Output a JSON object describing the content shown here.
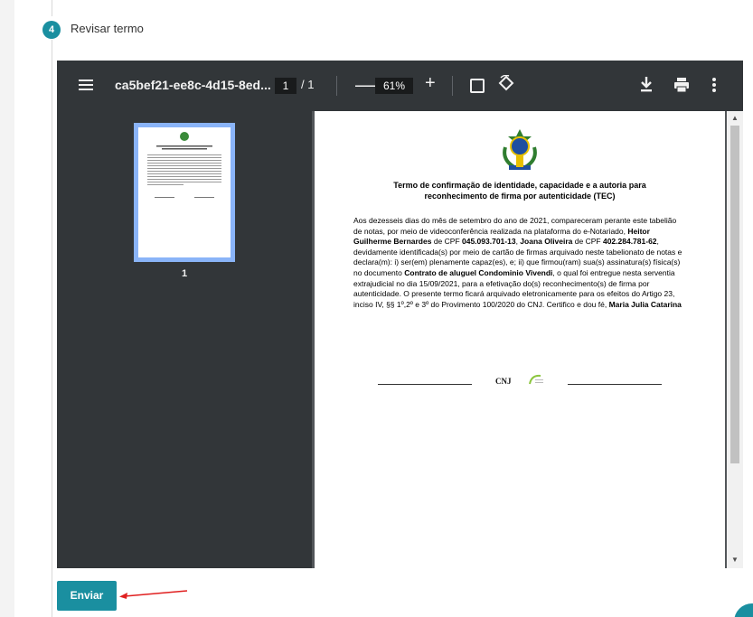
{
  "step": {
    "number": "4",
    "title": "Revisar termo"
  },
  "viewer": {
    "file_name": "ca5bef21-ee8c-4d15-8ed...",
    "current_page": "1",
    "page_total": "/  1",
    "zoom": "61%",
    "thumbnail_label": "1"
  },
  "document": {
    "heading_line1": "Termo de confirmação de identidade, capacidade e a autoria para",
    "heading_line2": "reconhecimento de firma por autenticidade (TEC)",
    "body": [
      {
        "t": "Aos dezesseis dias do mês de setembro do ano de 2021, compareceram perante este tabelião de notas, por meio de videoconferência realizada na plataforma do e-Notariado, ",
        "b": false
      },
      {
        "t": "Heitor Guilherme Bernardes",
        "b": true
      },
      {
        "t": " de CPF ",
        "b": false
      },
      {
        "t": "045.093.701-13",
        "b": true
      },
      {
        "t": ", ",
        "b": false
      },
      {
        "t": "Joana Oliveira",
        "b": true
      },
      {
        "t": " de CPF ",
        "b": false
      },
      {
        "t": "402.284.781-62",
        "b": true
      },
      {
        "t": ", devidamente identificada(s) por meio de cartão de firmas arquivado neste tabelionato de notas e declara(m): i) ser(em) plenamente capaz(es), e; ii) que firmou(ram) sua(s) assinatura(s) física(s) no documento ",
        "b": false
      },
      {
        "t": "Contrato de aluguel Condominio Vivendi",
        "b": true
      },
      {
        "t": ", o qual foi entregue nesta serventia extrajudicial no dia 15/09/2021, para a efetivação do(s) reconhecimento(s) de firma por autenticidade. O presente termo ficará arquivado eletronicamente para os efeitos do Artigo 23, inciso IV, §§ 1º,2º e 3º do Provimento 100/2020 do CNJ.  Certifico e dou fé, ",
        "b": false
      },
      {
        "t": "Maria Julia Catarina",
        "b": true
      }
    ],
    "cnj_label": "CNJ"
  },
  "actions": {
    "send_label": "Enviar"
  },
  "colors": {
    "accent": "#1a8fa0",
    "toolbar": "#323639",
    "arrow": "#e02020"
  },
  "icons": [
    "menu-icon",
    "zoom-out-icon",
    "zoom-in-icon",
    "fit-page-icon",
    "rotate-icon",
    "download-icon",
    "print-icon",
    "more-options-icon"
  ]
}
